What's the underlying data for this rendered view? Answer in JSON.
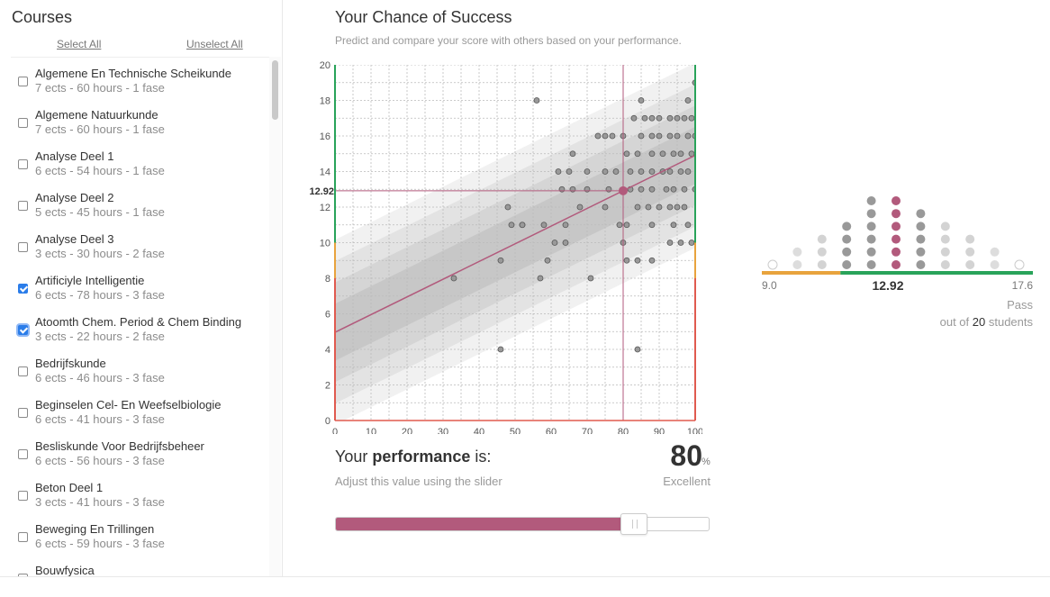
{
  "sidebar": {
    "title": "Courses",
    "select_all": "Select All",
    "unselect_all": "Unselect All",
    "courses": [
      {
        "name": "Algemene En Technische Scheikunde",
        "meta": "7 ects - 60 hours - 1 fase",
        "checked": false
      },
      {
        "name": "Algemene Natuurkunde",
        "meta": "7 ects - 60 hours - 1 fase",
        "checked": false
      },
      {
        "name": "Analyse Deel 1",
        "meta": "6 ects - 54 hours - 1 fase",
        "checked": false
      },
      {
        "name": "Analyse Deel 2",
        "meta": "5 ects - 45 hours - 1 fase",
        "checked": false
      },
      {
        "name": "Analyse Deel 3",
        "meta": "3 ects - 30 hours - 2 fase",
        "checked": false
      },
      {
        "name": "Artificiyle Intelligentie",
        "meta": "6 ects - 78 hours - 3 fase",
        "checked": true
      },
      {
        "name": "Atoomth Chem. Period & Chem Binding",
        "meta": "3 ects - 22 hours - 2 fase",
        "checked": true
      },
      {
        "name": "Bedrijfskunde",
        "meta": "6 ects - 46 hours - 3 fase",
        "checked": false
      },
      {
        "name": "Beginselen Cel- En Weefselbiologie",
        "meta": "6 ects - 41 hours - 3 fase",
        "checked": false
      },
      {
        "name": "Besliskunde Voor Bedrijfsbeheer",
        "meta": "6 ects - 56 hours - 3 fase",
        "checked": false
      },
      {
        "name": "Beton Deel 1",
        "meta": "3 ects - 41 hours - 3 fase",
        "checked": false
      },
      {
        "name": "Beweging En Trillingen",
        "meta": "6 ects - 59 hours - 3 fase",
        "checked": false
      },
      {
        "name": "Bouwfysica",
        "meta": "",
        "checked": false
      }
    ]
  },
  "main": {
    "title": "Your Chance of Success",
    "subtitle": "Predict and compare your score with others based on your performance.",
    "perf_prefix": "Your ",
    "perf_bold": "performance",
    "perf_suffix": " is:",
    "perf_value": "80",
    "perf_unit": "%",
    "perf_hint": "Adjust this value using the slider",
    "perf_grade": "Excellent",
    "slider_value": 0.8
  },
  "colors": {
    "accent": "#b25a7c",
    "dot_gray": "#999999",
    "fail": "#e8a33d",
    "pass": "#29a35a",
    "red_line": "#e05a4f"
  },
  "chart_data": {
    "type": "scatter",
    "xlim": [
      0,
      100
    ],
    "ylim": [
      0,
      20
    ],
    "x_ticks": [
      "0",
      "10",
      "20",
      "30",
      "40",
      "50",
      "60",
      "70",
      "80",
      "90",
      "100"
    ],
    "y_ticks": [
      "0",
      "2",
      "4",
      "6",
      "8",
      "10",
      "12",
      "14",
      "16",
      "18",
      "20"
    ],
    "selected_x": 80,
    "predicted_y": 12.92,
    "predicted_label": "12.92",
    "regression": {
      "intercept": 4.96,
      "slope": 0.0995
    },
    "pass_threshold": 10,
    "bands": [
      5.2,
      4.0,
      2.8,
      1.6
    ],
    "points": [
      [
        56,
        18
      ],
      [
        85,
        18
      ],
      [
        98,
        18
      ],
      [
        100,
        19
      ],
      [
        83,
        17
      ],
      [
        86,
        17
      ],
      [
        88,
        17
      ],
      [
        90,
        17
      ],
      [
        93,
        17
      ],
      [
        95,
        17
      ],
      [
        97,
        17
      ],
      [
        99,
        17
      ],
      [
        73,
        16
      ],
      [
        75,
        16
      ],
      [
        77,
        16
      ],
      [
        80,
        16
      ],
      [
        85,
        16
      ],
      [
        88,
        16
      ],
      [
        90,
        16
      ],
      [
        93,
        16
      ],
      [
        95,
        16
      ],
      [
        98,
        16
      ],
      [
        100,
        16
      ],
      [
        66,
        15
      ],
      [
        81,
        15
      ],
      [
        84,
        15
      ],
      [
        88,
        15
      ],
      [
        91,
        15
      ],
      [
        94,
        15
      ],
      [
        96,
        15
      ],
      [
        99,
        15
      ],
      [
        62,
        14
      ],
      [
        65,
        14
      ],
      [
        70,
        14
      ],
      [
        75,
        14
      ],
      [
        78,
        14
      ],
      [
        82,
        14
      ],
      [
        85,
        14
      ],
      [
        88,
        14
      ],
      [
        91,
        14
      ],
      [
        93,
        14
      ],
      [
        96,
        14
      ],
      [
        98,
        14
      ],
      [
        63,
        13
      ],
      [
        66,
        13
      ],
      [
        70,
        13
      ],
      [
        76,
        13
      ],
      [
        82,
        13
      ],
      [
        85,
        13
      ],
      [
        88,
        13
      ],
      [
        92,
        13
      ],
      [
        94,
        13
      ],
      [
        97,
        13
      ],
      [
        100,
        13
      ],
      [
        48,
        12
      ],
      [
        68,
        12
      ],
      [
        75,
        12
      ],
      [
        84,
        12
      ],
      [
        87,
        12
      ],
      [
        90,
        12
      ],
      [
        93,
        12
      ],
      [
        95,
        12
      ],
      [
        97,
        12
      ],
      [
        49,
        11
      ],
      [
        52,
        11
      ],
      [
        58,
        11
      ],
      [
        64,
        11
      ],
      [
        79,
        11
      ],
      [
        81,
        11
      ],
      [
        88,
        11
      ],
      [
        94,
        11
      ],
      [
        98,
        11
      ],
      [
        52,
        11
      ],
      [
        61,
        10
      ],
      [
        64,
        10
      ],
      [
        80,
        10
      ],
      [
        93,
        10
      ],
      [
        96,
        10
      ],
      [
        99,
        10
      ],
      [
        46,
        9
      ],
      [
        59,
        9
      ],
      [
        81,
        9
      ],
      [
        84,
        9
      ],
      [
        88,
        9
      ],
      [
        33,
        8
      ],
      [
        57,
        8
      ],
      [
        71,
        8
      ],
      [
        46,
        4
      ],
      [
        84,
        4
      ]
    ]
  },
  "distribution": {
    "min_label": "9.0",
    "max_label": "17.6",
    "value_label": "12.92",
    "result": "Pass",
    "count_prefix": "out of ",
    "count": "20",
    "count_suffix": " students",
    "columns": [
      1,
      2,
      3,
      4,
      6,
      6,
      5,
      4,
      3,
      2,
      1
    ],
    "highlight_column": 5,
    "fail_fraction": 0.29
  }
}
